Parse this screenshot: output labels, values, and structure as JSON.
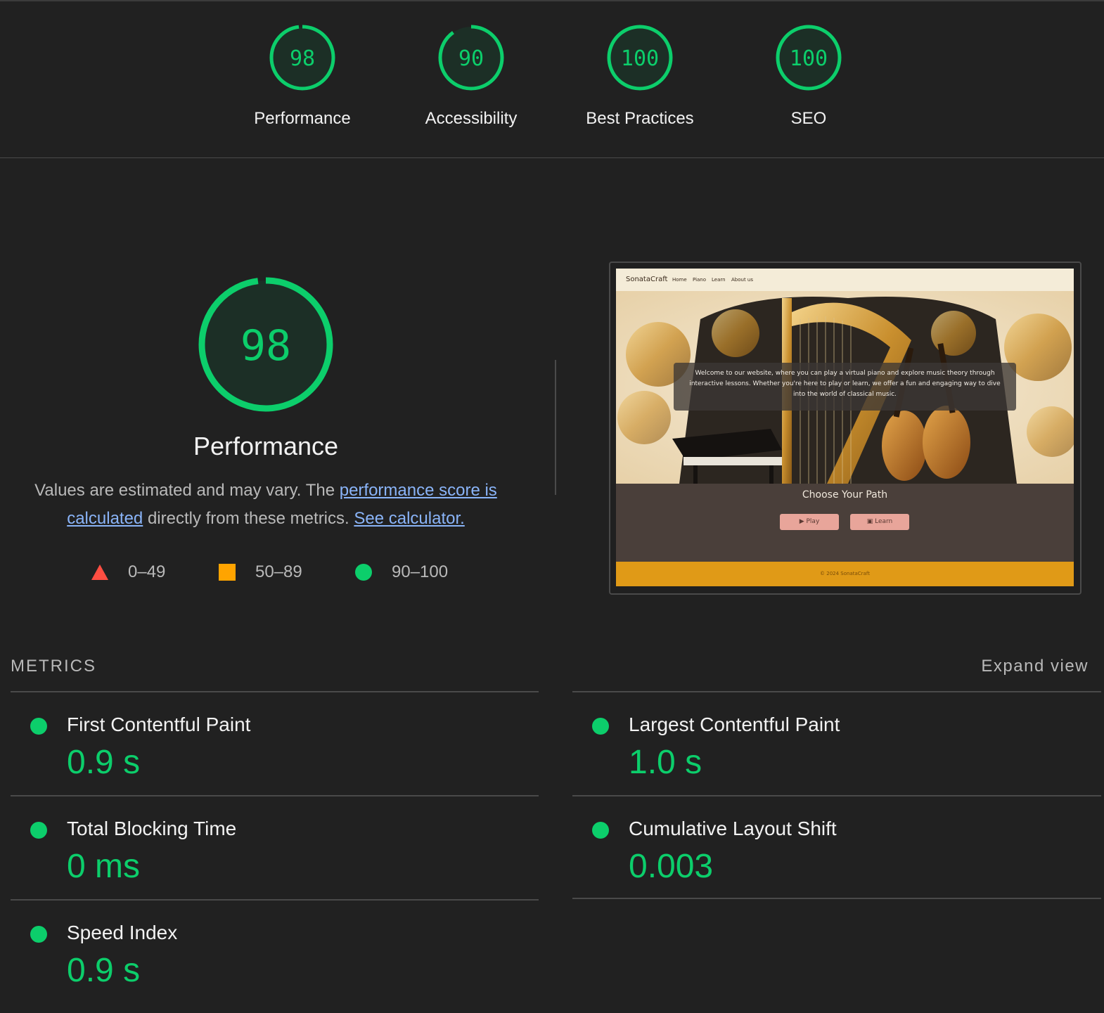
{
  "categories": [
    {
      "score": "98",
      "label": "Performance",
      "fraction": 0.98
    },
    {
      "score": "90",
      "label": "Accessibility",
      "fraction": 0.9
    },
    {
      "score": "100",
      "label": "Best Practices",
      "fraction": 1.0
    },
    {
      "score": "100",
      "label": "SEO",
      "fraction": 1.0
    }
  ],
  "performance": {
    "score": "98",
    "fraction": 0.98,
    "title": "Performance",
    "desc_prefix": "Values are estimated and may vary. The ",
    "link_score": "performance score is calculated",
    "desc_middle": " directly from these metrics. ",
    "link_calculator": "See calculator."
  },
  "legend": [
    {
      "range": "0–49",
      "shape": "triangle",
      "color": "#ff4e42"
    },
    {
      "range": "50–89",
      "shape": "square",
      "color": "#ffa400"
    },
    {
      "range": "90–100",
      "shape": "circle",
      "color": "#0cce6b"
    }
  ],
  "screenshot": {
    "brand": "SonataCraft",
    "nav": [
      "Home",
      "Piano",
      "Learn",
      "About us"
    ],
    "hero_text": "Welcome to our website, where you can play a virtual piano and explore music theory through interactive lessons. Whether you're here to play or learn, we offer a fun and engaging way to dive into the world of classical music.",
    "path_title": "Choose Your Path",
    "play_button": "▶ Play",
    "learn_button": "▣ Learn",
    "footer": "© 2024 SonataCraft"
  },
  "metrics_section": {
    "label": "METRICS",
    "expand": "Expand view"
  },
  "metrics": [
    {
      "name": "First Contentful Paint",
      "value": "0.9 s"
    },
    {
      "name": "Largest Contentful Paint",
      "value": "1.0 s"
    },
    {
      "name": "Total Blocking Time",
      "value": "0 ms"
    },
    {
      "name": "Cumulative Layout Shift",
      "value": "0.003"
    },
    {
      "name": "Speed Index",
      "value": "0.9 s"
    }
  ],
  "colors": {
    "pass": "#0cce6b",
    "pass_bg": "#1c2f26",
    "link": "#8ab4f8"
  }
}
